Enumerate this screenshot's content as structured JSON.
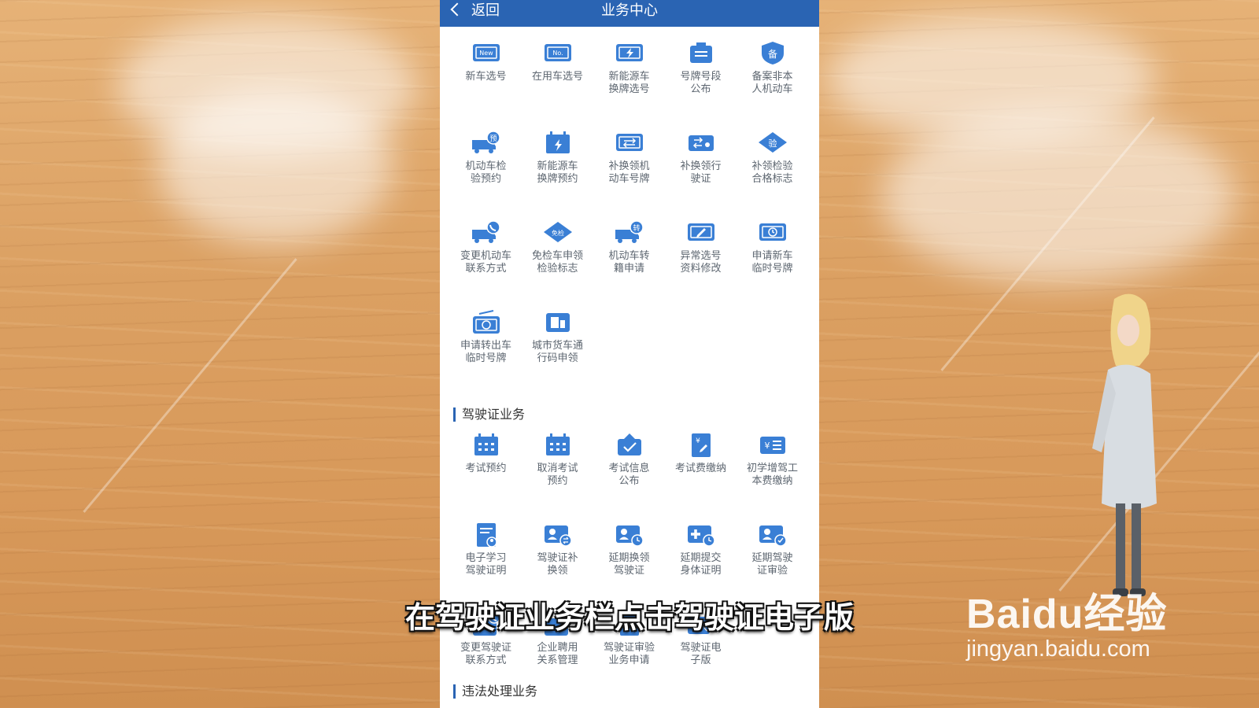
{
  "header": {
    "back_label": "返回",
    "title": "业务中心"
  },
  "vehicle_services": [
    {
      "label": "新车选号",
      "icon": "new-plate-icon"
    },
    {
      "label": "在用车选号",
      "icon": "no-plate-icon"
    },
    {
      "label": "新能源车\n换牌选号",
      "icon": "ev-plate-icon"
    },
    {
      "label": "号牌号段\n公布",
      "icon": "notice-icon"
    },
    {
      "label": "备案非本\n人机动车",
      "icon": "shield-record-icon"
    },
    {
      "label": "机动车检\n验预约",
      "icon": "truck-reserve-icon"
    },
    {
      "label": "新能源车\n换牌预约",
      "icon": "ev-calendar-icon"
    },
    {
      "label": "补换领机\n动车号牌",
      "icon": "plate-swap-icon"
    },
    {
      "label": "补换领行\n驶证",
      "icon": "license-swap-icon"
    },
    {
      "label": "补领检验\n合格标志",
      "icon": "inspection-diamond-icon"
    },
    {
      "label": "变更机动车\n联系方式",
      "icon": "truck-phone-icon"
    },
    {
      "label": "免检车申领\n检验标志",
      "icon": "exempt-diamond-icon"
    },
    {
      "label": "机动车转\n籍申请",
      "icon": "truck-transfer-icon"
    },
    {
      "label": "异常选号\n资料修改",
      "icon": "edit-plate-icon"
    },
    {
      "label": "申请新车\n临时号牌",
      "icon": "temp-plate-icon"
    },
    {
      "label": "申请转出车\n临时号牌",
      "icon": "temp-plate-clock-icon"
    },
    {
      "label": "城市货车通\n行码申领",
      "icon": "cargo-pass-icon"
    }
  ],
  "license_section_title": "驾驶证业务",
  "license_services": [
    {
      "label": "考试预约",
      "icon": "calendar-icon"
    },
    {
      "label": "取消考试\n预约",
      "icon": "calendar-cancel-icon"
    },
    {
      "label": "考试信息\n公布",
      "icon": "board-check-icon"
    },
    {
      "label": "考试费缴纳",
      "icon": "fee-doc-icon"
    },
    {
      "label": "初学增驾工\n本费缴纳",
      "icon": "fee-card-icon"
    },
    {
      "label": "电子学习\n驾驶证明",
      "icon": "study-doc-icon"
    },
    {
      "label": "驾驶证补\n换领",
      "icon": "license-renew-icon"
    },
    {
      "label": "延期换领\n驾驶证",
      "icon": "license-delay-icon"
    },
    {
      "label": "延期提交\n身体证明",
      "icon": "health-delay-icon"
    },
    {
      "label": "延期驾驶\n证审验",
      "icon": "license-verify-icon"
    },
    {
      "label": "变更驾驶证\n联系方式",
      "icon": "license-phone-icon"
    },
    {
      "label": "企业聘用\n关系管理",
      "icon": "company-icon"
    },
    {
      "label": "驾驶证审验\n业务申请",
      "icon": "audit-icon"
    },
    {
      "label": "驾驶证电\n子版",
      "icon": "e-license-icon"
    }
  ],
  "next_section_title": "违法处理业务",
  "caption": "在驾驶证业务栏点击驾驶证电子版",
  "brand": {
    "name": "Baidu经验",
    "url": "jingyan.baidu.com"
  },
  "colors": {
    "header": "#2a64b3",
    "icon": "#3a7fd5",
    "label": "#5d6670"
  }
}
